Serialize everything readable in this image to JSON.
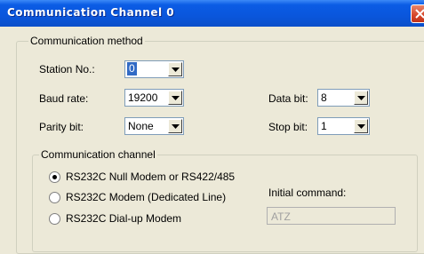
{
  "window": {
    "title": "Communication Channel 0"
  },
  "communication_method": {
    "legend": "Communication method",
    "station_no": {
      "label": "Station No.:",
      "value": "0"
    },
    "baud_rate": {
      "label": "Baud rate:",
      "value": "19200"
    },
    "data_bit": {
      "label": "Data bit:",
      "value": "8"
    },
    "parity_bit": {
      "label": "Parity bit:",
      "value": "None"
    },
    "stop_bit": {
      "label": "Stop bit:",
      "value": "1"
    }
  },
  "communication_channel": {
    "legend": "Communication channel",
    "options": [
      {
        "label": "RS232C Null Modem or RS422/485",
        "selected": true
      },
      {
        "label": "RS232C Modem (Dedicated Line)",
        "selected": false
      },
      {
        "label": "RS232C Dial-up Modem",
        "selected": false
      }
    ],
    "initial_command": {
      "label": "Initial command:",
      "value": "ATZ"
    }
  },
  "colors": {
    "title_bar": "#0a56dc",
    "dialog_bg": "#ece9d8",
    "selection": "#316ac5",
    "close_button": "#d5462a"
  },
  "icons": {
    "close": "close-x-icon",
    "dropdown": "chevron-down-icon"
  }
}
